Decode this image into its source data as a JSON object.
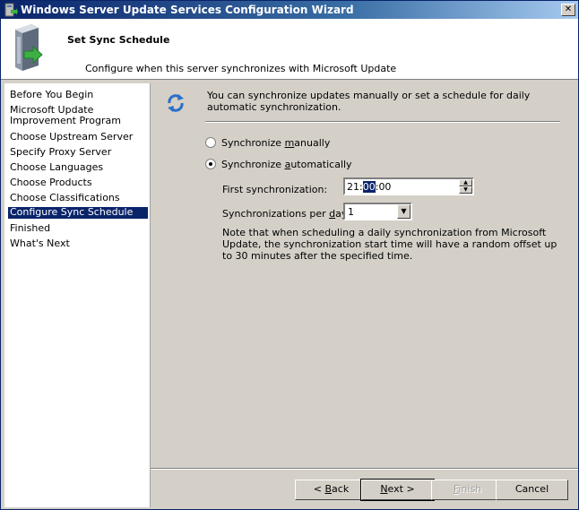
{
  "window": {
    "title": "Windows Server Update Services Configuration Wizard",
    "close_glyph": "✕"
  },
  "header": {
    "heading": "Set Sync Schedule",
    "subheading": "Configure when this server synchronizes with Microsoft Update"
  },
  "sidebar": {
    "items": [
      {
        "label": "Before You Begin"
      },
      {
        "label": "Microsoft Update Improvement Program"
      },
      {
        "label": "Choose Upstream Server"
      },
      {
        "label": "Specify Proxy Server"
      },
      {
        "label": "Choose Languages"
      },
      {
        "label": "Choose Products"
      },
      {
        "label": "Choose Classifications"
      },
      {
        "label": "Configure Sync Schedule"
      },
      {
        "label": "Finished"
      },
      {
        "label": "What's Next"
      }
    ],
    "active_index": 7
  },
  "content": {
    "intro": "You can synchronize updates manually or set a schedule for daily automatic synchronization.",
    "option_manual": {
      "prefix": "Synchronize ",
      "accel": "m",
      "suffix": "anually",
      "checked": false
    },
    "option_auto": {
      "prefix": "Synchronize ",
      "accel": "a",
      "suffix": "utomatically",
      "checked": true
    },
    "first_sync_label": "First synchronization:",
    "first_sync_time": {
      "hour": "21",
      "sep1": ":",
      "minute": "00",
      "sep2": ":",
      "second": "00"
    },
    "per_day_label": {
      "prefix": "Synchronizations per ",
      "accel": "d",
      "suffix": "ay:"
    },
    "per_day_value": "1",
    "note": "Note that when scheduling a daily synchronization from Microsoft Update, the synchronization start time will have a random offset up to 30 minutes after the specified time."
  },
  "buttons": {
    "back": {
      "prefix": "< ",
      "accel": "B",
      "suffix": "ack"
    },
    "next": {
      "accel": "N",
      "suffix": "ext >"
    },
    "finish": {
      "accel": "F",
      "suffix": "inish"
    },
    "cancel": "Cancel"
  },
  "colors": {
    "selection": "#0a246a",
    "face": "#d4d0c8"
  }
}
